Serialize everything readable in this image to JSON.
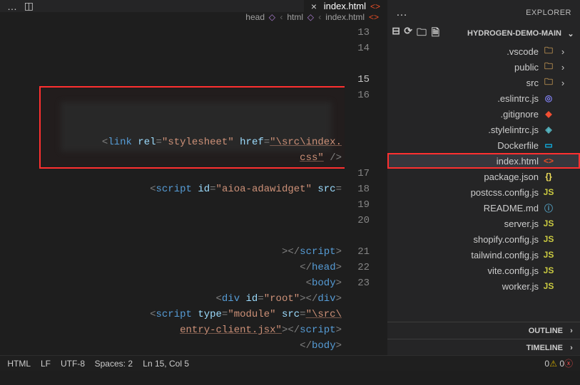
{
  "explorer": {
    "title": "EXPLORER",
    "more_label": "…"
  },
  "project": {
    "name": "HYDROGEN-DEMO-MAIN",
    "actions": [
      "new-file",
      "new-folder",
      "refresh",
      "collapse"
    ]
  },
  "tree": [
    {
      "type": "folder",
      "label": ".vscode",
      "icon": "folder-i"
    },
    {
      "type": "folder",
      "label": "public",
      "icon": "folder-i"
    },
    {
      "type": "folder",
      "label": "src",
      "icon": "folder-i"
    },
    {
      "type": "file",
      "label": ".eslintrc.js",
      "icon": "eslint",
      "glyph": "◎"
    },
    {
      "type": "file",
      "label": ".gitignore",
      "icon": "git",
      "glyph": "◆"
    },
    {
      "type": "file",
      "label": ".stylelintrc.js",
      "icon": "style",
      "glyph": "◈"
    },
    {
      "type": "file",
      "label": "Dockerfile",
      "icon": "docker",
      "glyph": "▭"
    },
    {
      "type": "file",
      "label": "index.html",
      "icon": "html",
      "glyph": "<>",
      "selected": true
    },
    {
      "type": "file",
      "label": "package.json",
      "icon": "json",
      "glyph": "{}"
    },
    {
      "type": "file",
      "label": "postcss.config.js",
      "icon": "js",
      "glyph": "JS"
    },
    {
      "type": "file",
      "label": "README.md",
      "icon": "md",
      "glyph": "ⓘ"
    },
    {
      "type": "file",
      "label": "server.js",
      "icon": "js",
      "glyph": "JS"
    },
    {
      "type": "file",
      "label": "shopify.config.js",
      "icon": "js",
      "glyph": "JS"
    },
    {
      "type": "file",
      "label": "tailwind.config.js",
      "icon": "js",
      "glyph": "JS"
    },
    {
      "type": "file",
      "label": "vite.config.js",
      "icon": "js",
      "glyph": "JS"
    },
    {
      "type": "file",
      "label": "worker.js",
      "icon": "js",
      "glyph": "JS"
    }
  ],
  "sections": {
    "outline": "OUTLINE",
    "timeline": "TIMELINE"
  },
  "tab": {
    "label": "index.html",
    "close": "×"
  },
  "breadcrumb": {
    "file": "index.html",
    "path1": "html",
    "path2": "head"
  },
  "code": {
    "first_line": 13,
    "current_line": 15,
    "lines": [
      {
        "n": 13,
        "html": ""
      },
      {
        "n": 14,
        "html": "    <span class='tok-punc'>&lt;</span><span class='tok-tag'>link</span> <span class='tok-attr'>rel</span><span class='tok-punc'>=</span><span class='tok-str-nu'>\"stylesheet\"</span> <span class='tok-attr'>href</span><span class='tok-punc'>=</span><span class='tok-str'>\"\\src\\index.</span>"
      },
      {
        "n": 0,
        "html": "    <span class='tok-str'>css\"</span> <span class='tok-punc'>/&gt;</span>"
      },
      {
        "n": 15,
        "html": ""
      },
      {
        "n": 16,
        "html": "    <span class='tok-punc'>&lt;</span><span class='tok-tag'>script</span> <span class='tok-attr'>id</span><span class='tok-punc'>=</span><span class='tok-str-nu'>\"aioa-adawidget\"</span> <span class='tok-attr'>src</span><span class='tok-punc'>=</span>"
      },
      {
        "n": 0,
        "html": ""
      },
      {
        "n": 0,
        "html": ""
      },
      {
        "n": 0,
        "html": ""
      },
      {
        "n": 0,
        "html": "                                  <span class='tok-punc'>&gt;&lt;/</span><span class='tok-tag'>script</span><span class='tok-punc'>&gt;</span>"
      },
      {
        "n": 17,
        "html": "  <span class='tok-punc'>&lt;/</span><span class='tok-tag'>head</span><span class='tok-punc'>&gt;</span>"
      },
      {
        "n": 18,
        "html": "  <span class='tok-punc'>&lt;</span><span class='tok-tag'>body</span><span class='tok-punc'>&gt;</span>"
      },
      {
        "n": 19,
        "html": "    <span class='tok-punc'>&lt;</span><span class='tok-tag'>div</span> <span class='tok-attr'>id</span><span class='tok-punc'>=</span><span class='tok-str-nu'>\"root\"</span><span class='tok-punc'>&gt;&lt;/</span><span class='tok-tag'>div</span><span class='tok-punc'>&gt;</span>"
      },
      {
        "n": 20,
        "html": "    <span class='tok-punc'>&lt;</span><span class='tok-tag'>script</span> <span class='tok-attr'>type</span><span class='tok-punc'>=</span><span class='tok-str-nu'>\"module\"</span> <span class='tok-attr'>src</span><span class='tok-punc'>=</span><span class='tok-str'>\"\\src\\</span>"
      },
      {
        "n": 0,
        "html": "    <span class='tok-str'>entry-client.jsx\"</span><span class='tok-punc'>&gt;&lt;/</span><span class='tok-tag'>script</span><span class='tok-punc'>&gt;</span>"
      },
      {
        "n": 21,
        "html": "  <span class='tok-punc'>&lt;/</span><span class='tok-tag'>body</span><span class='tok-punc'>&gt;</span>"
      },
      {
        "n": 22,
        "html": "<span class='tok-punc'>&lt;/</span><span class='tok-tag'>html</span><span class='tok-punc'>&gt;</span>"
      },
      {
        "n": 23,
        "html": ""
      }
    ]
  },
  "status": {
    "errors": "0",
    "warnings": "0",
    "cursor": "Ln 15, Col 5",
    "spaces": "Spaces: 2",
    "encoding": "UTF-8",
    "eol": "LF",
    "lang": "HTML"
  }
}
